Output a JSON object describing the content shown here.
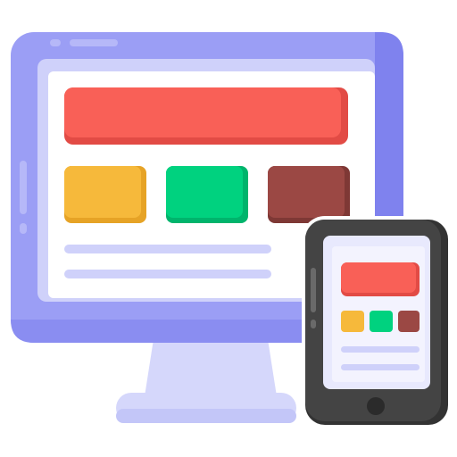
{
  "illustration": {
    "subject": "responsive-design-icon",
    "monitor": {
      "frame_color": "#9b9ef5",
      "frame_shade_color": "#7f82ee",
      "screen_bezel_color": "#cfd1fa",
      "screen_color": "#ffffff",
      "stand_color": "#d5d7fb",
      "stand_shade_color": "#c3c6f8",
      "content": {
        "banner_color": "#f96057",
        "blocks": [
          {
            "name": "block-yellow",
            "color": "#f6b93b"
          },
          {
            "name": "block-green",
            "color": "#00d27f"
          },
          {
            "name": "block-brown",
            "color": "#9b4844"
          }
        ],
        "text_line_color": "#cfd1fa",
        "text_lines": 2
      }
    },
    "phone": {
      "body_color": "#444444",
      "body_shade_color": "#333333",
      "screen_color": "#e8e9fd",
      "home_button_color": "#2b2b2b",
      "content": {
        "banner_color": "#f96057",
        "blocks": [
          {
            "name": "block-yellow",
            "color": "#f6b93b"
          },
          {
            "name": "block-green",
            "color": "#00d27f"
          },
          {
            "name": "block-brown",
            "color": "#9b4844"
          }
        ],
        "text_line_color": "#cfd1fa",
        "text_lines": 2
      }
    }
  }
}
